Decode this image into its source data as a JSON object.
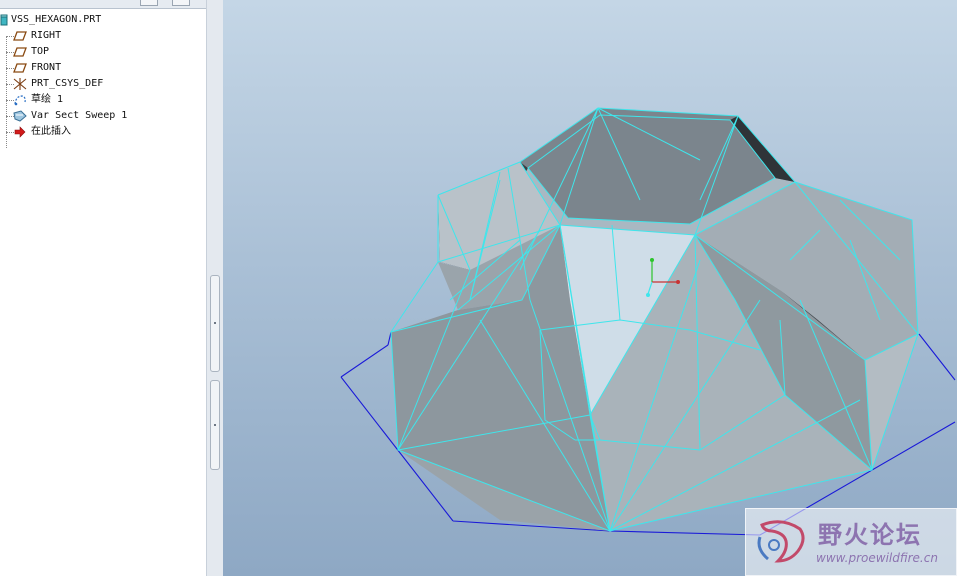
{
  "model_tree": {
    "root": "VSS_HEXAGON.PRT",
    "items": [
      {
        "label": "RIGHT",
        "icon": "datum-plane-icon"
      },
      {
        "label": "TOP",
        "icon": "datum-plane-icon"
      },
      {
        "label": "FRONT",
        "icon": "datum-plane-icon"
      },
      {
        "label": "PRT_CSYS_DEF",
        "icon": "coordinate-system-icon"
      },
      {
        "label": "草绘 1",
        "icon": "sketch-icon"
      },
      {
        "label": "Var Sect Sweep 1",
        "icon": "sweep-feature-icon"
      },
      {
        "label": "在此插入",
        "icon": "insert-here-arrow-icon"
      }
    ]
  },
  "watermark": {
    "title": "野火论坛",
    "url": "www.proewildfire.cn"
  },
  "colors": {
    "viewport_top": "#c4d6e6",
    "viewport_bottom": "#8ea8c4",
    "wireframe": "#3ee6ec",
    "sketch_outline": "#1a1ad8",
    "datum_plane": "#8a4a12"
  }
}
